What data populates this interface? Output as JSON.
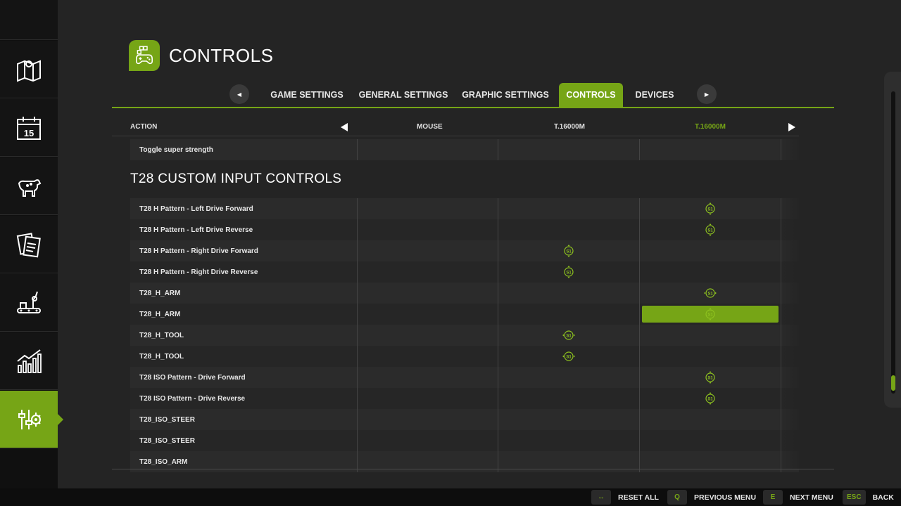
{
  "header": {
    "title": "CONTROLS"
  },
  "tabs": [
    {
      "label": "GAME SETTINGS"
    },
    {
      "label": "GENERAL SETTINGS"
    },
    {
      "label": "GRAPHIC SETTINGS"
    },
    {
      "label": "CONTROLS",
      "active": true
    },
    {
      "label": "DEVICES"
    }
  ],
  "sidebar": {
    "items": [
      {
        "icon": "map-icon"
      },
      {
        "icon": "calendar-icon",
        "text": "15"
      },
      {
        "icon": "cow-icon"
      },
      {
        "icon": "contracts-icon"
      },
      {
        "icon": "production-icon"
      },
      {
        "icon": "statistics-icon"
      },
      {
        "icon": "settings-icon",
        "active": true
      }
    ]
  },
  "table": {
    "columns": {
      "action": "ACTION",
      "col1": "MOUSE",
      "col2": "T.16000M",
      "col3": "T.16000M"
    },
    "top_row": {
      "label": "Toggle super strength"
    },
    "section_title": "T28 CUSTOM INPUT CONTROLS",
    "rows": [
      {
        "label": "T28 H Pattern - Left Drive Forward"
      },
      {
        "label": "T28 H Pattern - Left Drive Reverse"
      },
      {
        "label": "T28 H Pattern - Right Drive Forward"
      },
      {
        "label": "T28 H Pattern - Right Drive Reverse"
      },
      {
        "label": "T28_H_ARM"
      },
      {
        "label": "T28_H_ARM"
      },
      {
        "label": "T28_H_TOOL"
      },
      {
        "label": "T28_H_TOOL"
      },
      {
        "label": "T28 ISO Pattern - Drive Forward"
      },
      {
        "label": "T28 ISO Pattern - Drive Reverse"
      },
      {
        "label": "T28_ISO_STEER"
      },
      {
        "label": "T28_ISO_STEER"
      },
      {
        "label": "T28_ISO_ARM"
      }
    ],
    "axis_label": "S1"
  },
  "footer": [
    {
      "key": "↔",
      "label": "RESET ALL"
    },
    {
      "key": "Q",
      "label": "PREVIOUS MENU"
    },
    {
      "key": "E",
      "label": "NEXT MENU"
    },
    {
      "key": "ESC",
      "label": "BACK"
    }
  ],
  "colors": {
    "accent": "#76a516",
    "background": "#242424",
    "sidebar": "#141414"
  }
}
